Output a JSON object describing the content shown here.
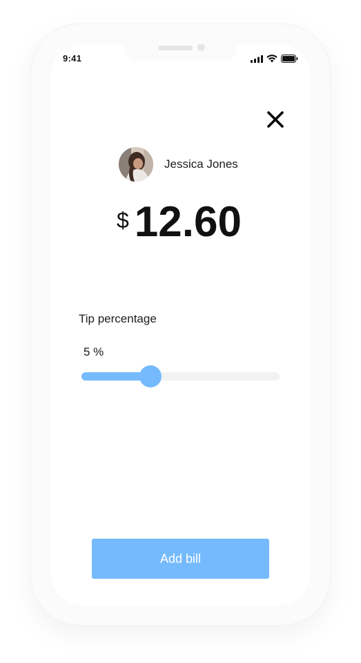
{
  "status_bar": {
    "time": "9:41",
    "icons": [
      "cellular-signal-icon",
      "wifi-icon",
      "battery-icon"
    ]
  },
  "header": {
    "close_icon": "close-icon"
  },
  "user": {
    "name": "Jessica Jones",
    "avatar_icon": "avatar-photo"
  },
  "bill": {
    "currency": "$",
    "amount": "12.60"
  },
  "tip": {
    "label": "Tip percentage",
    "value_text": "5 %",
    "slider_fraction": 0.35
  },
  "actions": {
    "add_bill_label": "Add bill"
  },
  "colors": {
    "accent": "#75bafd",
    "track": "#f2f2f2",
    "text": "#111111"
  }
}
